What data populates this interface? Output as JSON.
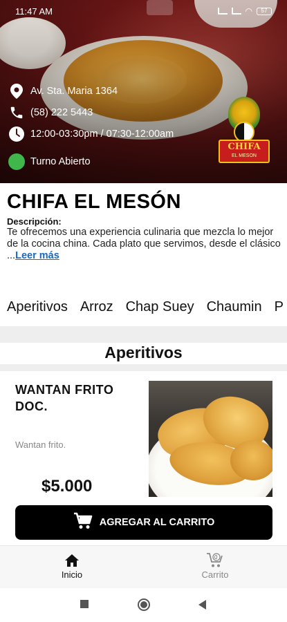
{
  "status_bar": {
    "time": "11:47 AM",
    "battery": "57"
  },
  "restaurant": {
    "address": "Av. Sta. Maria 1364",
    "phone": "(58) 222 5443",
    "hours": "12:00-03:30pm / 07:30-12:00am",
    "status": "Turno Abierto",
    "status_color": "#3fb74a",
    "logo_text": "CHIFA",
    "logo_subtext": "EL MESON",
    "name": "CHIFA EL MESÓN",
    "description_label": "Descripción:",
    "description": "Te ofrecemos una experiencia culinaria que mezcla lo mejor de la cocina china. Cada plato que servimos, desde el clásico ...",
    "read_more": "Leer más"
  },
  "categories": [
    "Aperitivos",
    "Arroz",
    "Chap Suey",
    "Chaumin",
    "P"
  ],
  "section": {
    "title": "Aperitivos"
  },
  "product": {
    "name": "WANTAN FRITO DOC.",
    "description": "Wantan frito.",
    "price": "$5.000",
    "add_to_cart": "AGREGAR AL CARRITO"
  },
  "bottom_nav": {
    "home": "Inicio",
    "cart": "Carrito",
    "cart_count": "0"
  },
  "colors": {
    "accent": "#000000",
    "link": "#1769c4"
  }
}
